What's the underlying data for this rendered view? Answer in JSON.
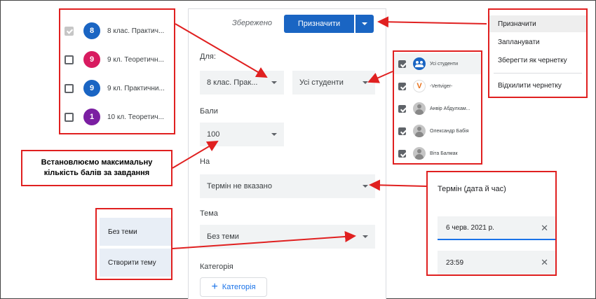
{
  "class_list": [
    {
      "number": "8",
      "label": "8 клас. Практич...",
      "color": "#1a65c3",
      "checked": "grey"
    },
    {
      "number": "9",
      "label": "9 кл. Теоретичн...",
      "color": "#d81b60",
      "checked": "no"
    },
    {
      "number": "9",
      "label": "9 кл. Практични...",
      "color": "#1a65c3",
      "checked": "no"
    },
    {
      "number": "1",
      "label": "10 кл. Теоретич...",
      "color": "#7b1fa2",
      "checked": "no"
    }
  ],
  "main": {
    "saved_status": "Збережено",
    "assign_button": "Призначити",
    "for_label": "Для:",
    "class_select": "8 клас. Прак...",
    "students_select": "Усі студенти",
    "points_label": "Бали",
    "points_value": "100",
    "due_label": "На",
    "due_value": "Термін не вказано",
    "topic_label": "Тема",
    "topic_value": "Без теми",
    "category_label": "Категорія",
    "add_category_button": "Категорія"
  },
  "assign_menu": [
    "Призначити",
    "Запланувати",
    "Зберегти як чернетку",
    "Відхилити чернетку"
  ],
  "students": [
    {
      "name": "Усі студенти",
      "avatar": "group-icon"
    },
    {
      "name": "-Vertviger-",
      "avatar": "v-logo"
    },
    {
      "name": "Анвір Абдулхам...",
      "avatar": "person-icon"
    },
    {
      "name": "Олександр Бабія",
      "avatar": "person-icon"
    },
    {
      "name": "Віта Балмак",
      "avatar": "person-icon"
    }
  ],
  "callout": "Встановлюємо максимальну кількість балів за завдання",
  "topic_menu": [
    "Без теми",
    "Створити тему"
  ],
  "due_panel": {
    "title": "Термін (дата й час)",
    "date": "6 черв. 2021 р.",
    "time": "23:59"
  },
  "colors": {
    "primary": "#1a65c3",
    "annotation": "#e02020"
  }
}
